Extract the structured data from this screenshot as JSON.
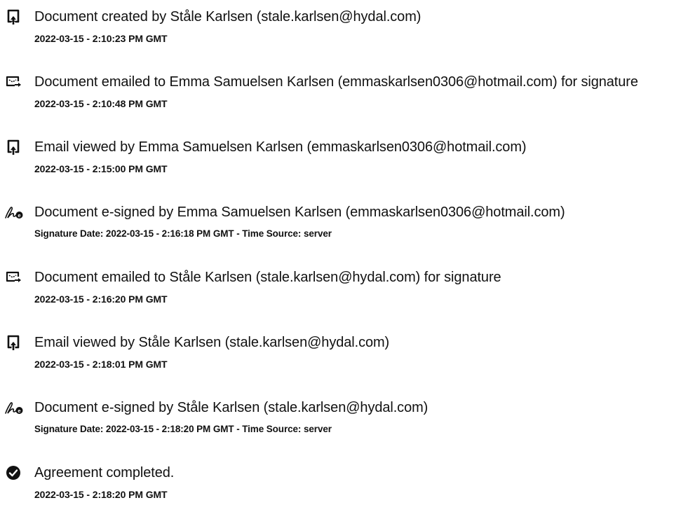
{
  "events": [
    {
      "icon": "document-created-icon",
      "title": "Document created by Ståle Karlsen (stale.karlsen@hydal.com)",
      "detail": "2022-03-15 - 2:10:23 PM GMT"
    },
    {
      "icon": "email-sent-icon",
      "title": "Document emailed to Emma Samuelsen Karlsen (emmaskarlsen0306@hotmail.com) for signature",
      "detail": "2022-03-15 - 2:10:48 PM GMT"
    },
    {
      "icon": "email-viewed-icon",
      "title": "Email viewed by Emma Samuelsen Karlsen (emmaskarlsen0306@hotmail.com)",
      "detail": "2022-03-15 - 2:15:00 PM GMT"
    },
    {
      "icon": "e-signature-icon",
      "title": "Document e-signed by Emma Samuelsen Karlsen (emmaskarlsen0306@hotmail.com)",
      "detail": "Signature Date: 2022-03-15 - 2:16:18 PM GMT - Time Source: server"
    },
    {
      "icon": "email-sent-icon",
      "title": "Document emailed to Ståle Karlsen (stale.karlsen@hydal.com) for signature",
      "detail": "2022-03-15 - 2:16:20 PM GMT"
    },
    {
      "icon": "email-viewed-icon",
      "title": "Email viewed by Ståle Karlsen (stale.karlsen@hydal.com)",
      "detail": "2022-03-15 - 2:18:01 PM GMT"
    },
    {
      "icon": "e-signature-icon",
      "title": "Document e-signed by Ståle Karlsen (stale.karlsen@hydal.com)",
      "detail": "Signature Date: 2022-03-15 - 2:18:20 PM GMT - Time Source: server"
    },
    {
      "icon": "agreement-completed-icon",
      "title": "Agreement completed.",
      "detail": "2022-03-15 - 2:18:20 PM GMT"
    }
  ]
}
